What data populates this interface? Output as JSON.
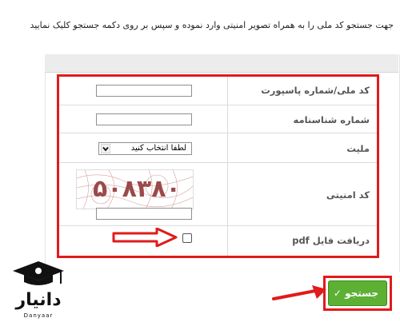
{
  "instruction": "جهت جستجو کد ملی را به همراه تصویر امنیتی وارد نموده و سپس بر روی دکمه جستجو کلیک نمایید",
  "form": {
    "national_code_label": "کد ملی/شماره پاسپورت",
    "national_code_value": "",
    "id_number_label": "شماره شناسنامه",
    "id_number_value": "",
    "nationality_label": "ملیت",
    "nationality_selected": "لطفا انتخاب کنید",
    "security_code_label": "کد امنیتی",
    "captcha_text": "۵۰۸۳۸۰",
    "security_code_value": "",
    "pdf_label": "دریافت فایل pdf",
    "pdf_checked": false
  },
  "search_button_label": "جستجو",
  "search_button_icon": "check-icon",
  "logo": {
    "text_fa": "دانیار",
    "text_en": "Danyaar"
  },
  "colors": {
    "highlight_red": "#e01b1b",
    "button_green": "#5cb034",
    "header_gray": "#ececec"
  }
}
